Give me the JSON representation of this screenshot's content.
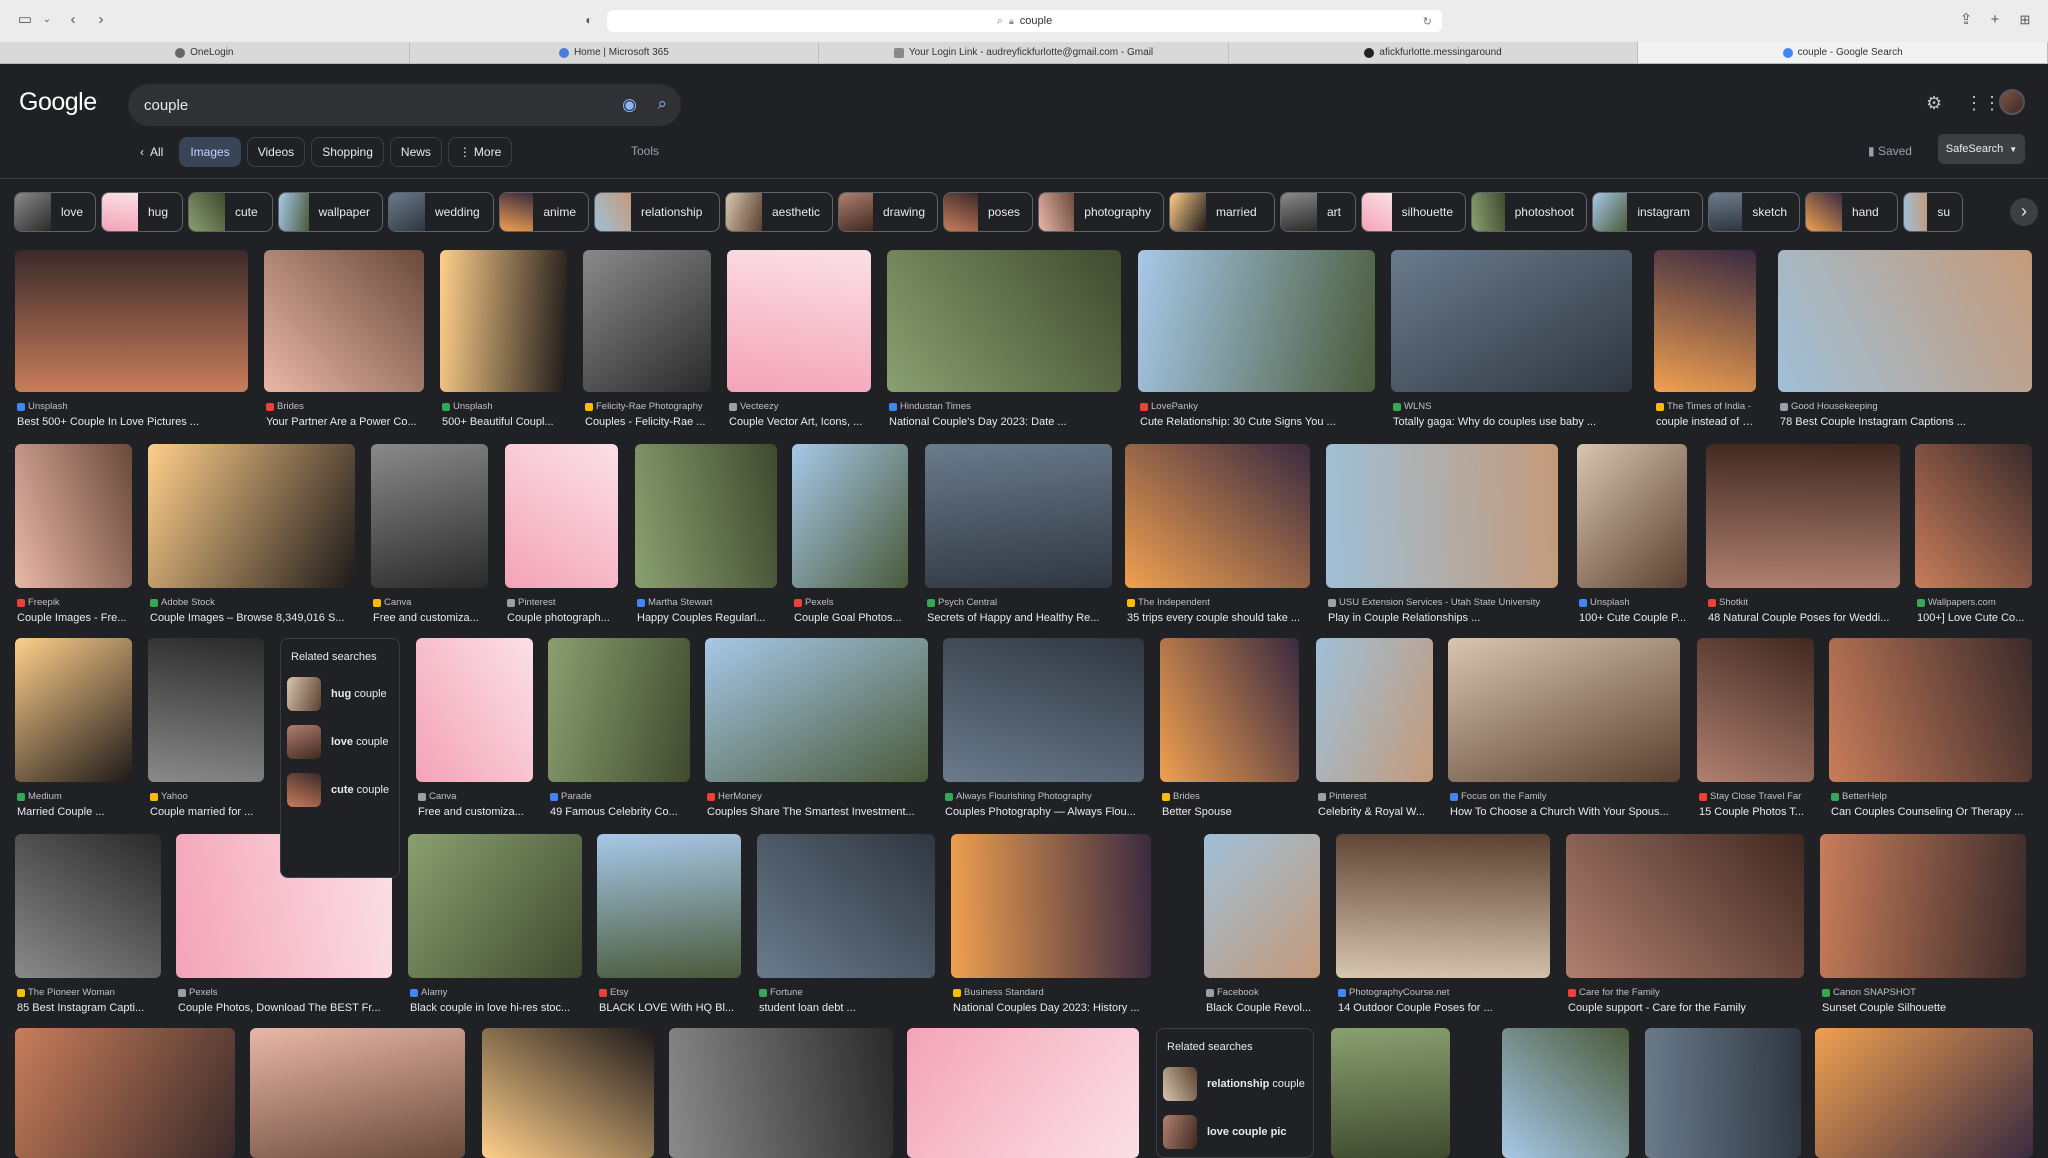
{
  "browser": {
    "url": "couple",
    "tabs": [
      "OneLogin",
      "Home | Microsoft 365",
      "Your Login Link - audreyfickfurlotte@gmail.com - Gmail",
      "afickfurlotte.messingaround",
      "couple - Google Search"
    ]
  },
  "google": {
    "logo": "Google",
    "query": "couple",
    "nav": [
      "All",
      "Images",
      "Videos",
      "Shopping",
      "News",
      "More"
    ],
    "tools": "Tools",
    "saved": "Saved",
    "safesearch": "SafeSearch"
  },
  "chips": [
    "love",
    "hug",
    "cute",
    "wallpaper",
    "wedding",
    "anime",
    "relationship",
    "aesthetic",
    "drawing",
    "poses",
    "photography",
    "married",
    "art",
    "silhouette",
    "photoshoot",
    "instagram",
    "sketch",
    "hand",
    "su"
  ],
  "rows": [
    [
      {
        "s": "Unsplash",
        "t": "Best 500+ Couple In Love Pictures ..."
      },
      {
        "s": "Brides",
        "t": "Your Partner Are a Power Co..."
      },
      {
        "s": "Unsplash",
        "t": "500+ Beautiful Coupl..."
      },
      {
        "s": "Felicity-Rae Photography",
        "t": "Couples - Felicity-Rae ..."
      },
      {
        "s": "Vecteezy",
        "t": "Couple Vector Art, Icons, ..."
      },
      {
        "s": "Hindustan Times",
        "t": "National Couple's Day 2023: Date ..."
      },
      {
        "s": "LovePanky",
        "t": "Cute Relationship: 30 Cute Signs You ..."
      },
      {
        "s": "WLNS",
        "t": "Totally gaga: Why do couples use baby ..."
      },
      {
        "s": "The Times of India -",
        "t": "couple instead of bi..."
      },
      {
        "s": "Good Housekeeping",
        "t": "78 Best Couple Instagram Captions ..."
      }
    ],
    [
      {
        "s": "Freepik",
        "t": "Couple Images - Fre..."
      },
      {
        "s": "Adobe Stock",
        "t": "Couple Images – Browse 8,349,016 S..."
      },
      {
        "s": "Canva",
        "t": "Free and customiza..."
      },
      {
        "s": "Pinterest",
        "t": "Couple photograph..."
      },
      {
        "s": "Martha Stewart",
        "t": "Happy Couples Regularl..."
      },
      {
        "s": "Pexels",
        "t": "Couple Goal Photos..."
      },
      {
        "s": "Psych Central",
        "t": "Secrets of Happy and Healthy Re..."
      },
      {
        "s": "The Independent",
        "t": "35 trips every couple should take ..."
      },
      {
        "s": "USU Extension Services - Utah State University",
        "t": "Play in Couple Relationships ..."
      },
      {
        "s": "Unsplash",
        "t": "100+ Cute Couple P..."
      },
      {
        "s": "Shotkit",
        "t": "48 Natural Couple Poses for Weddi..."
      },
      {
        "s": "Wallpapers.com",
        "t": "100+] Love Cute Co..."
      }
    ],
    [
      {
        "s": "Medium",
        "t": "Married Couple ..."
      },
      {
        "s": "Yahoo",
        "t": "Couple married for ..."
      },
      {
        "s": "Canva",
        "t": "Free and customiza..."
      },
      {
        "s": "Parade",
        "t": "49 Famous Celebrity Co..."
      },
      {
        "s": "HerMoney",
        "t": "Couples Share The Smartest Investment..."
      },
      {
        "s": "Always Flourishing Photography",
        "t": "Couples Photography — Always Flou..."
      },
      {
        "s": "Brides",
        "t": "Better Spouse"
      },
      {
        "s": "Pinterest",
        "t": "Celebrity & Royal W..."
      },
      {
        "s": "Focus on the Family",
        "t": "How To Choose a Church With Your Spous..."
      },
      {
        "s": "Stay Close Travel Far",
        "t": "15 Couple Photos T..."
      },
      {
        "s": "BetterHelp",
        "t": "Can Couples Counseling Or Therapy ..."
      }
    ],
    [
      {
        "s": "The Pioneer Woman",
        "t": "85 Best Instagram Capti..."
      },
      {
        "s": "Pexels",
        "t": "Couple Photos, Download The BEST Fr..."
      },
      {
        "s": "Alamy",
        "t": "Black couple in love hi-res stoc..."
      },
      {
        "s": "Etsy",
        "t": "BLACK LOVE With HQ Bl..."
      },
      {
        "s": "Fortune",
        "t": "student loan debt ..."
      },
      {
        "s": "Business Standard",
        "t": "National Couples Day 2023: History ..."
      },
      {
        "s": "Facebook",
        "t": "Black Couple Revol..."
      },
      {
        "s": "PhotographyCourse.net",
        "t": "14 Outdoor Couple Poses for ..."
      },
      {
        "s": "Care for the Family",
        "t": "Couple support - Care for the Family"
      },
      {
        "s": "Canon SNAPSHOT",
        "t": "Sunset Couple Silhouette"
      }
    ]
  ],
  "related1": {
    "heading": "Related searches",
    "items": [
      {
        "b": "hug",
        "r": " couple"
      },
      {
        "b": "love",
        "r": " couple"
      },
      {
        "b": "cute",
        "r": " couple"
      }
    ]
  },
  "related2": {
    "heading": "Related searches",
    "items": [
      {
        "b": "relationship",
        "r": " couple"
      },
      {
        "b": "love couple pic",
        "r": ""
      }
    ]
  }
}
